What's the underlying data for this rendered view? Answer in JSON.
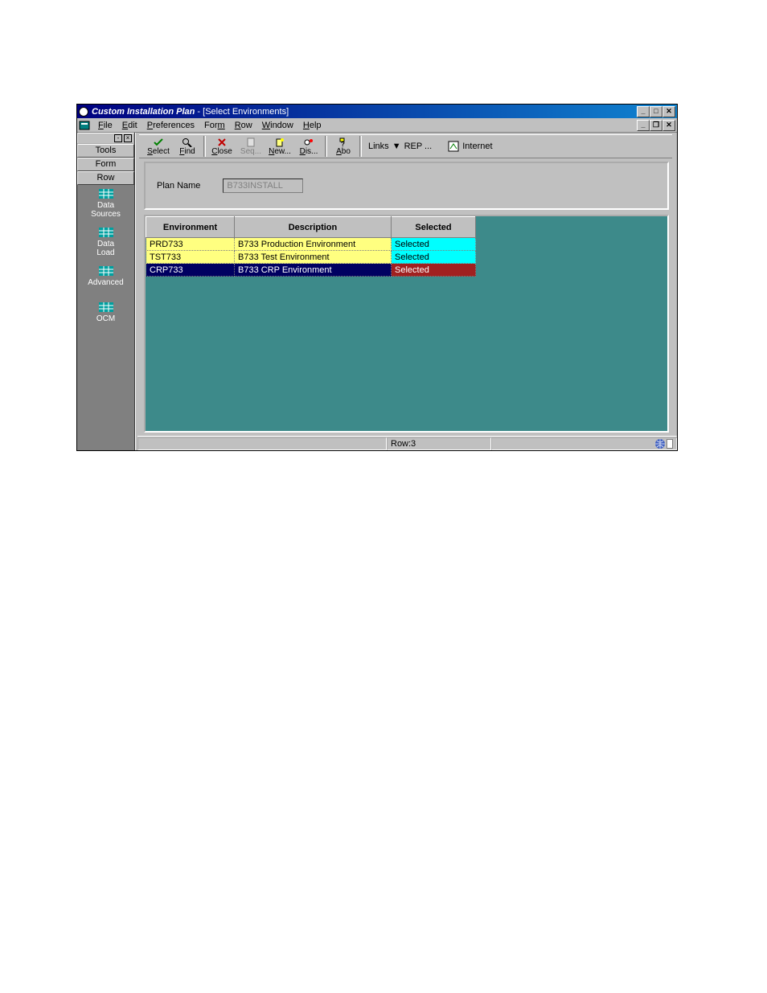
{
  "window": {
    "app_title": "Custom Installation Plan",
    "doc_title": " - [Select Environments]"
  },
  "menus": {
    "file": "File",
    "edit": "Edit",
    "preferences": "Preferences",
    "form": "Form",
    "row": "Row",
    "window": "Window",
    "help": "Help"
  },
  "sidebar": {
    "tabs": {
      "tools": "Tools",
      "form": "Form",
      "row": "Row"
    },
    "tools": [
      {
        "label1": "Data",
        "label2": "Sources"
      },
      {
        "label1": "Data",
        "label2": "Load"
      },
      {
        "label1": "Advanced",
        "label2": ""
      },
      {
        "label1": "OCM",
        "label2": ""
      }
    ]
  },
  "toolbar": {
    "select": "Select",
    "find": "Find",
    "close": "Close",
    "seq": "Seq...",
    "new": "New...",
    "dis": "Dis...",
    "abo": "Abo",
    "links": "Links",
    "rep": "REP ...",
    "internet": "Internet"
  },
  "form": {
    "plan_name_label": "Plan Name",
    "plan_name_value": "B733INSTALL"
  },
  "grid": {
    "cols": {
      "env": "Environment",
      "desc": "Description",
      "sel": "Selected"
    },
    "rows": [
      {
        "env": "PRD733",
        "desc": "B733 Production Environment",
        "sel": "Selected",
        "style": "yellow"
      },
      {
        "env": "TST733",
        "desc": "B733 Test Environment",
        "sel": "Selected",
        "style": "yellow"
      },
      {
        "env": "CRP733",
        "desc": "B733 CRP Environment",
        "sel": "Selected",
        "style": "dark"
      }
    ]
  },
  "status": {
    "row": "Row:3"
  }
}
